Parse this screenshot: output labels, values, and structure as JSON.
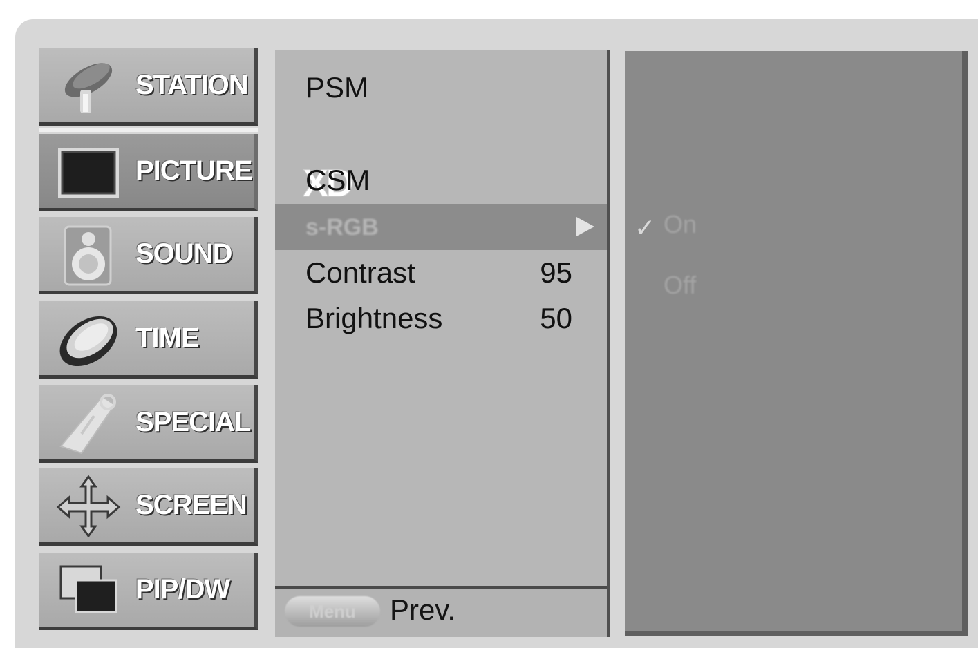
{
  "sidebar": {
    "items": [
      {
        "label": "STATION",
        "icon": "satellite-dish-icon"
      },
      {
        "label": "PICTURE",
        "icon": "tv-screen-icon"
      },
      {
        "label": "SOUND",
        "icon": "speaker-icon"
      },
      {
        "label": "TIME",
        "icon": "clock-icon"
      },
      {
        "label": "SPECIAL",
        "icon": "remote-control-icon"
      },
      {
        "label": "SCREEN",
        "icon": "move-arrows-icon"
      },
      {
        "label": "PIP/DW",
        "icon": "pip-windows-icon"
      }
    ],
    "active": "PICTURE"
  },
  "picture_menu": {
    "items": [
      {
        "label": "PSM",
        "value": ""
      },
      {
        "label": "XD",
        "value": ""
      },
      {
        "label": "CSM",
        "value": ""
      },
      {
        "label": "s-RGB",
        "value": ""
      },
      {
        "label": "Contrast",
        "value": "95"
      },
      {
        "label": "Brightness",
        "value": "50"
      }
    ],
    "selected": "s-RGB"
  },
  "submenu": {
    "options": [
      {
        "label": "On",
        "checked": true
      },
      {
        "label": "Off",
        "checked": false
      }
    ],
    "check_glyph": "✓"
  },
  "footer": {
    "menu_button_label": "Menu",
    "prev_label": "Prev."
  },
  "colors": {
    "frame": "#d7d7d7",
    "sidebar_item": "#b3b3b3",
    "sidebar_active": "#8c8c8c",
    "menu_panel": "#b7b7b7",
    "selected_row": "#8c8c8c",
    "submenu_panel": "#8a8a8a"
  }
}
